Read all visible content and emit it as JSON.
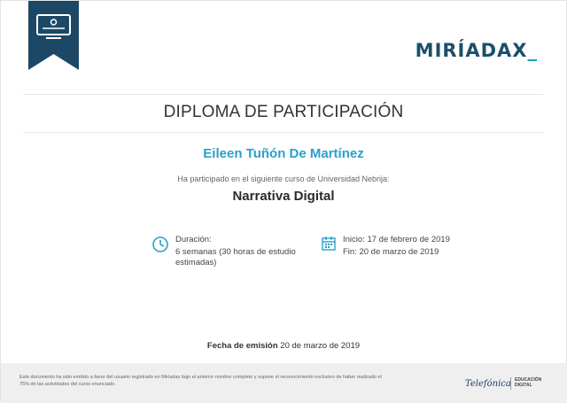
{
  "brand": {
    "logo_main": "MIRÍADAX",
    "logo_cursor": "_",
    "ribbon_icon": "monitor-certificate-icon",
    "ribbon_color": "#1c4866",
    "accent_color": "#2b9fc9"
  },
  "diploma": {
    "title": "DIPLOMA DE PARTICIPACIÓN",
    "recipient": "Eileen Tuñón De Martínez",
    "intro": "Ha participado en el siguiente curso de Universidad Nebrija:",
    "course": "Narrativa Digital"
  },
  "details": {
    "duration_icon": "clock-icon",
    "duration_label": "Duración:",
    "duration_value": "6 semanas (30 horas de estudio estimadas)",
    "calendar_icon": "calendar-icon",
    "start": "Inicio: 17 de febrero de 2019",
    "end": "Fin: 20 de marzo de 2019"
  },
  "issue": {
    "label": "Fecha de emisión",
    "date": "20 de marzo de 2019"
  },
  "footer": {
    "legal": "Este documento ha sido emitido a favor del usuario registrado en Miríadax bajo el anterior nombre completo y supone el reconocimiento exclusivo de haber realizado el 75% de las actividades del curso enunciado.",
    "partner": "Telefónica",
    "partner_line1": "EDUCACIÓN",
    "partner_line2": "DIGITAL"
  }
}
